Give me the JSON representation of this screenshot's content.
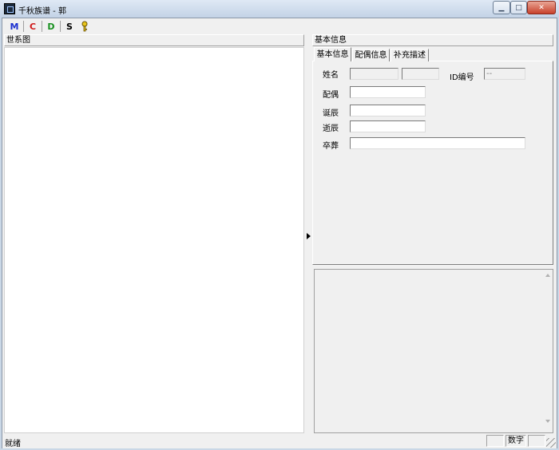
{
  "window": {
    "title": "千秋族谱 - 郭"
  },
  "toolbar": {
    "m_label": "M",
    "m_color": "#1a2fd0",
    "c_label": "C",
    "c_color": "#d01a1a",
    "d_label": "D",
    "d_color": "#17901f",
    "s_label": "S",
    "s_color": "#000000",
    "help_icon": "key-help-icon"
  },
  "left_pane": {
    "header": "世系图"
  },
  "right_pane": {
    "header": "基本信息",
    "tabs": [
      {
        "label": "基本信息"
      },
      {
        "label": "配偶信息"
      },
      {
        "label": "补充描述"
      }
    ],
    "form": {
      "name_label": "姓名",
      "surname_value": "",
      "given_name_value": "",
      "id_label": "ID编号",
      "id_value": "--",
      "spouse_label": "配偶",
      "spouse_value": "",
      "birth_label": "诞辰",
      "birth_value": "",
      "death_label": "逝辰",
      "death_value": "",
      "burial_label": "卒葬",
      "burial_value": ""
    }
  },
  "status_bar": {
    "text": "就绪",
    "numlock": "数字"
  }
}
